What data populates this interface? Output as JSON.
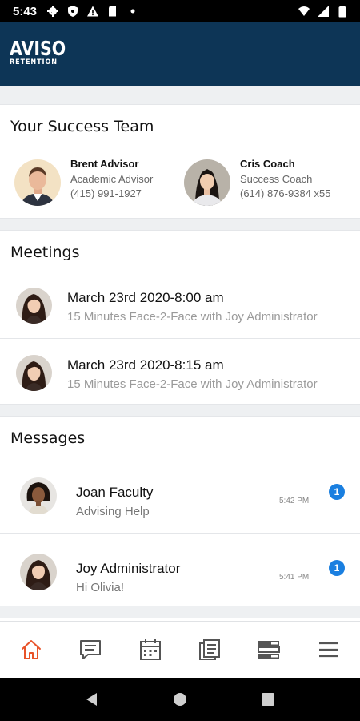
{
  "status_bar": {
    "time": "5:43"
  },
  "header": {
    "logo_main": "AVISO",
    "logo_sub": "RETENTION"
  },
  "success_team": {
    "title": "Your Success Team",
    "members": [
      {
        "name": "Brent Advisor",
        "role": "Academic Advisor",
        "phone": "(415) 991-1927"
      },
      {
        "name": "Cris Coach",
        "role": "Success Coach",
        "phone": "(614) 876-9384 x55"
      }
    ]
  },
  "meetings": {
    "title": "Meetings",
    "items": [
      {
        "date": "March 23rd 2020-8:00 am",
        "desc": "15 Minutes Face-2-Face with Joy Administrator"
      },
      {
        "date": "March 23rd 2020-8:15 am",
        "desc": "15 Minutes Face-2-Face with Joy Administrator"
      }
    ]
  },
  "messages": {
    "title": "Messages",
    "items": [
      {
        "name": "Joan Faculty",
        "preview": "Advising Help",
        "time": "5:42 PM",
        "unread": "1"
      },
      {
        "name": "Joy Administrator",
        "preview": "Hi Olivia!",
        "time": "5:41 PM",
        "unread": "1"
      }
    ]
  },
  "nav": {
    "active": "home",
    "items": [
      "home-icon",
      "messages-icon",
      "calendar-icon",
      "notes-icon",
      "list-view-icon",
      "menu-icon"
    ]
  },
  "colors": {
    "header_bg": "#0d3556",
    "accent_active": "#e8542a",
    "badge": "#1a7fe0"
  }
}
